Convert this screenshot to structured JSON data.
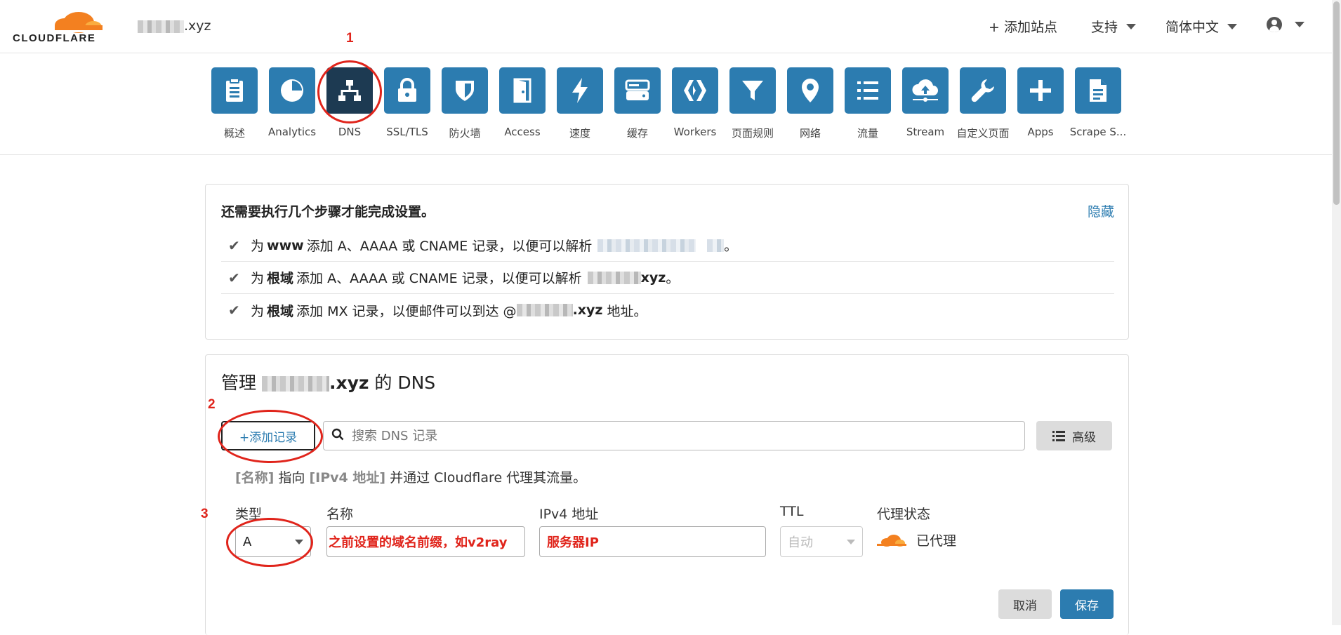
{
  "header": {
    "logo_text": "CLOUDFLARE",
    "domain_suffix": ".xyz",
    "add_site": "+ 添加站点",
    "support": "支持",
    "language": "简体中文"
  },
  "nav": {
    "items": [
      {
        "label": "概述",
        "icon": "document-icon"
      },
      {
        "label": "Analytics",
        "icon": "pie-chart-icon"
      },
      {
        "label": "DNS",
        "icon": "network-icon"
      },
      {
        "label": "SSL/TLS",
        "icon": "lock-icon"
      },
      {
        "label": "防火墙",
        "icon": "shield-icon"
      },
      {
        "label": "Access",
        "icon": "door-icon"
      },
      {
        "label": "速度",
        "icon": "lightning-icon"
      },
      {
        "label": "缓存",
        "icon": "server-icon"
      },
      {
        "label": "Workers",
        "icon": "workers-icon"
      },
      {
        "label": "页面规则",
        "icon": "filter-icon"
      },
      {
        "label": "网络",
        "icon": "location-pin-icon"
      },
      {
        "label": "流量",
        "icon": "list-icon"
      },
      {
        "label": "Stream",
        "icon": "cloud-upload-icon"
      },
      {
        "label": "自定义页面",
        "icon": "wrench-icon"
      },
      {
        "label": "Apps",
        "icon": "plus-icon"
      },
      {
        "label": "Scrape S...",
        "icon": "page-icon"
      }
    ],
    "active": "DNS"
  },
  "setup": {
    "title": "还需要执行几个步骤才能完成设置。",
    "hide": "隐藏",
    "steps": [
      {
        "pre": "为",
        "bold": "www",
        "text": "添加 A、AAAA 或 CNAME 记录，以便可以解析",
        "tail": "。"
      },
      {
        "pre": "为",
        "bold": "根域",
        "text": "添加 A、AAAA 或 CNAME 记录，以便可以解析",
        "tail": "xyz",
        "end": "。"
      },
      {
        "pre": "为",
        "bold": "根域",
        "text": "添加 MX 记录，以便邮件可以到达 @",
        "tail": ".xyz",
        "end": "地址。"
      }
    ]
  },
  "dns": {
    "title_pre": "管理",
    "title_domain": ".xyz",
    "title_post": "的 DNS",
    "add_record": "+添加记录",
    "search_placeholder": "搜索 DNS 记录",
    "advanced": "高级",
    "hint": {
      "name": "[名称]",
      "mid": "指向",
      "ip": "[IPv4 地址]",
      "end": "并通过 Cloudflare 代理其流量。"
    },
    "form": {
      "type_label": "类型",
      "type_value": "A",
      "name_label": "名称",
      "name_value": "之前设置的域名前缀，如v2ray",
      "ipv4_label": "IPv4 地址",
      "ipv4_value": "服务器IP",
      "ttl_label": "TTL",
      "ttl_value": "自动",
      "proxy_label": "代理状态",
      "proxy_value": "已代理"
    },
    "cancel": "取消",
    "save": "保存"
  },
  "annotations": [
    "1",
    "2",
    "3"
  ],
  "colors": {
    "accent": "#2c7cb0",
    "active_tile": "#1d3a52",
    "annotation": "#e0241b",
    "cloud_orange": "#f38020"
  }
}
